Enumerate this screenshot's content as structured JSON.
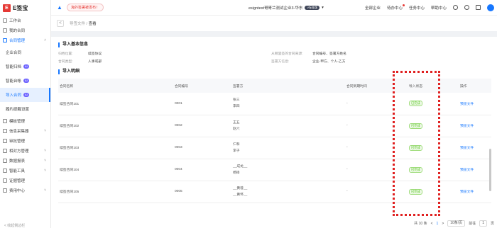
{
  "app": {
    "logo_mark": "E",
    "logo_text": "E签宝"
  },
  "sidebar": {
    "items": [
      {
        "label": "工作台",
        "icon": "home-icon"
      },
      {
        "label": "我的合同",
        "icon": "doc-icon"
      },
      {
        "label": "合同管理",
        "icon": "file-manage-icon",
        "active": true,
        "chev": "^"
      },
      {
        "label": "企业合同",
        "sub": true
      },
      {
        "label": "智能归档",
        "sub": true,
        "badge": "AI"
      },
      {
        "label": "智能台帐",
        "sub": true,
        "badge": "AI"
      },
      {
        "label": "导入合同",
        "sub": true,
        "badge": "AI",
        "selected": true
      },
      {
        "label": "履约提醒设置",
        "sub": true
      },
      {
        "label": "模板管理",
        "icon": "template-icon"
      },
      {
        "label": "信息采集器",
        "icon": "collect-icon",
        "chev": "v"
      },
      {
        "label": "审批管理",
        "icon": "approve-icon"
      },
      {
        "label": "相对方管理",
        "icon": "partner-icon",
        "chev": "v"
      },
      {
        "label": "数据报表",
        "icon": "report-icon",
        "chev": "v"
      },
      {
        "label": "智能工具",
        "icon": "tool-icon",
        "chev": "v"
      },
      {
        "label": "证据管理",
        "icon": "evidence-icon"
      },
      {
        "label": "费用中心",
        "icon": "fee-icon",
        "chev": "v"
      }
    ],
    "collapse_label": "< 收起侧边栏"
  },
  "header": {
    "promo": "海外签署被发布！",
    "org_name": "esigntest哥哥兰测试企业3-华东",
    "version_badge": "V标准版",
    "all_orgs": "全部企业",
    "nav": [
      "待办中心",
      "任务中心",
      "帮助中心"
    ]
  },
  "breadcrumb": {
    "parent": "导签文件",
    "current": "查看"
  },
  "basic": {
    "title": "导入基本信息",
    "fields": [
      {
        "k": "归档位置:",
        "v": "续签协议"
      },
      {
        "k": "从哪里签的合同来源:",
        "v": "合同编号、签署方姓名"
      },
      {
        "k": "合同类型:",
        "v": "人事或部"
      },
      {
        "k": "签署方信息:",
        "v": "企业-甲方、个人-乙方"
      }
    ]
  },
  "detail": {
    "title": "导入明细",
    "columns": [
      "合同名称",
      "合同编号",
      "签署方",
      "合同到期时间",
      "导入状态",
      "操作"
    ],
    "rows": [
      {
        "name": "续签合同101",
        "no": "0001",
        "signers": [
          "张三",
          "李四"
        ],
        "expire": "-",
        "status": "已完成",
        "action": "预览文件"
      },
      {
        "name": "续签合同102",
        "no": "0002",
        "signers": [
          "王五",
          "赵六"
        ],
        "expire": "-",
        "status": "已完成",
        "action": "预览文件"
      },
      {
        "name": "续签合同103",
        "no": "0003",
        "signers": [
          "仁和",
          "李子"
        ],
        "expire": "-",
        "status": "已完成",
        "action": "预览文件"
      },
      {
        "name": "续签合同104",
        "no": "0004",
        "signers": [
          "__成龙__",
          "杨锋"
        ],
        "expire": "-",
        "status": "已完成",
        "action": "预览文件"
      },
      {
        "name": "续签合同105",
        "no": "0005",
        "signers": [
          "__黄蓉__",
          "__黄怀__"
        ],
        "expire": "-",
        "status": "已完成",
        "action": "预览文件"
      }
    ]
  },
  "pager": {
    "total": "共 10 条",
    "page": "1",
    "size": "10条/页",
    "goto": "前往",
    "goto_val": "1",
    "unit": "页"
  },
  "colors": {
    "accent": "#1677ff",
    "highlight": "#e02020",
    "success": "#52c41a"
  }
}
